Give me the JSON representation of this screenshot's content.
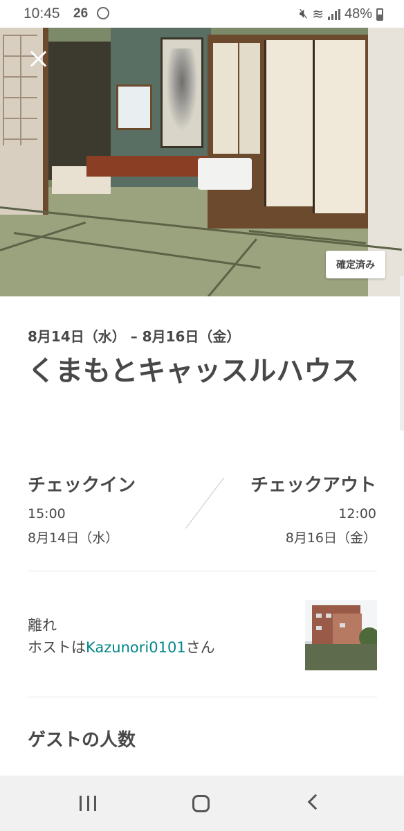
{
  "status_bar": {
    "time": "10:45",
    "temperature": "26",
    "battery": "48%"
  },
  "hero": {
    "badge": "確定済み"
  },
  "reservation": {
    "dates": "8月14日（水） – 8月16日（金）",
    "title": "くまもとキャッスルハウス",
    "checkin": {
      "label": "チェックイン",
      "time": "15:00",
      "date": "8月14日（水）"
    },
    "checkout": {
      "label": "チェックアウト",
      "time": "12:00",
      "date": "8月16日（金）"
    },
    "room_type": "離れ",
    "host_prefix": "ホストは",
    "host_name": "Kazunori0101",
    "host_suffix": "さん",
    "guests_heading": "ゲストの人数"
  },
  "colors": {
    "text": "#484848",
    "link": "#008489",
    "nav_bg": "#f1f1f1"
  }
}
